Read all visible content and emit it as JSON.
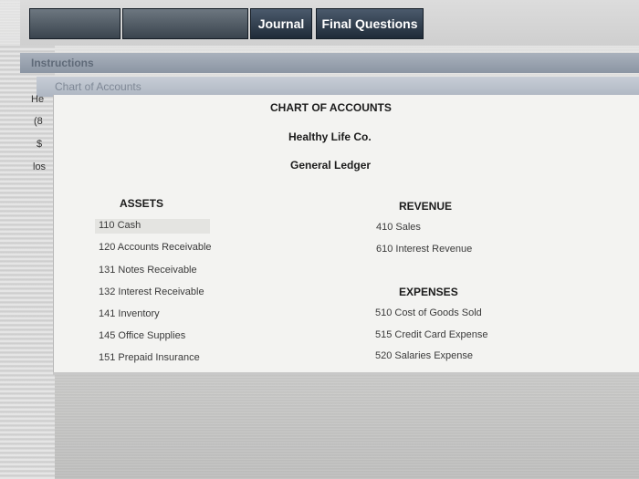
{
  "tabs": {
    "journal": "Journal",
    "final_questions": "Final Questions"
  },
  "instructions_tab": "Instructions",
  "chart_of_accounts_tab": "Chart of Accounts",
  "side_labels": [
    "He",
    "(8",
    "$",
    "los"
  ],
  "chart": {
    "heading": "CHART OF ACCOUNTS",
    "company": "Healthy Life Co.",
    "ledger": "General Ledger",
    "assets_heading": "ASSETS",
    "assets": [
      "110  Cash",
      "120  Accounts Receivable",
      "131  Notes Receivable",
      "132  Interest Receivable",
      "141  Inventory",
      "145  Office Supplies",
      "151  Prepaid Insurance"
    ],
    "revenue_heading": "REVENUE",
    "revenue": [
      "410  Sales",
      "610  Interest Revenue"
    ],
    "expenses_heading": "EXPENSES",
    "expenses": [
      "510  Cost of Goods Sold",
      "515  Credit Card Expense",
      "520  Salaries Expense"
    ]
  }
}
